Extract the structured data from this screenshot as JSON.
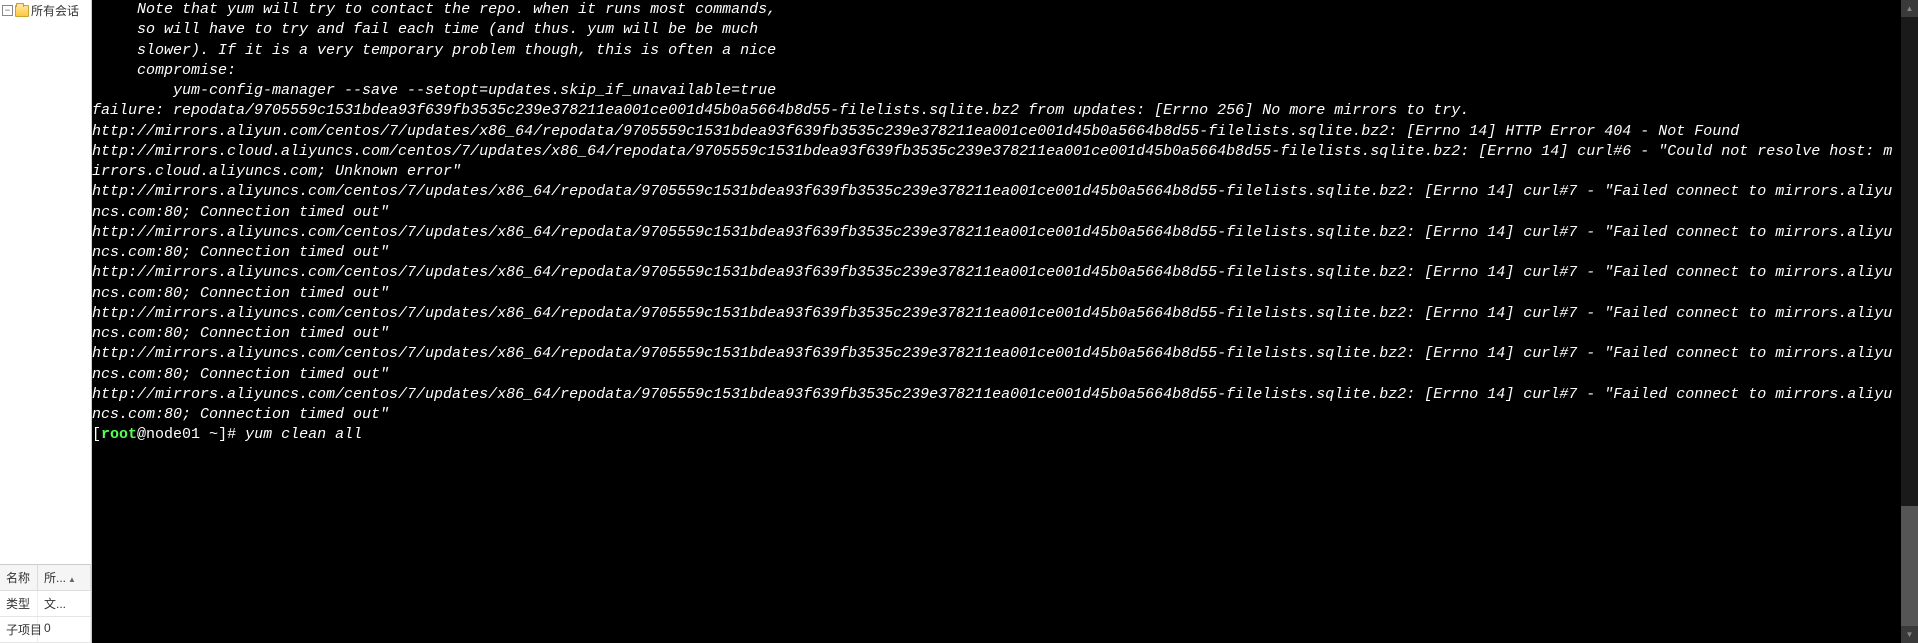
{
  "sidebar": {
    "tree": {
      "label": "所有会话"
    },
    "grid": {
      "headers": [
        "名称",
        "所..."
      ],
      "rows": [
        [
          "类型",
          "文..."
        ],
        [
          "子项目",
          "0"
        ]
      ]
    }
  },
  "terminal": {
    "note_lines": [
      "     Note that yum will try to contact the repo. when it runs most commands,",
      "     so will have to try and fail each time (and thus. yum will be be much",
      "     slower). If it is a very temporary problem though, this is often a nice",
      "     compromise:",
      "",
      "         yum-config-manager --save --setopt=updates.skip_if_unavailable=true",
      ""
    ],
    "failure_line": "failure: repodata/9705559c1531bdea93f639fb3535c239e378211ea001ce001d45b0a5664b8d55-filelists.sqlite.bz2 from updates: [Errno 256] No more mirrors to try.",
    "error_lines": [
      "http://mirrors.aliyun.com/centos/7/updates/x86_64/repodata/9705559c1531bdea93f639fb3535c239e378211ea001ce001d45b0a5664b8d55-filelists.sqlite.bz2: [Errno 14] HTTP Error 404 - Not Found",
      "http://mirrors.cloud.aliyuncs.com/centos/7/updates/x86_64/repodata/9705559c1531bdea93f639fb3535c239e378211ea001ce001d45b0a5664b8d55-filelists.sqlite.bz2: [Errno 14] curl#6 - \"Could not resolve host: mirrors.cloud.aliyuncs.com; Unknown error\"",
      "http://mirrors.aliyuncs.com/centos/7/updates/x86_64/repodata/9705559c1531bdea93f639fb3535c239e378211ea001ce001d45b0a5664b8d55-filelists.sqlite.bz2: [Errno 14] curl#7 - \"Failed connect to mirrors.aliyuncs.com:80; Connection timed out\"",
      "http://mirrors.aliyuncs.com/centos/7/updates/x86_64/repodata/9705559c1531bdea93f639fb3535c239e378211ea001ce001d45b0a5664b8d55-filelists.sqlite.bz2: [Errno 14] curl#7 - \"Failed connect to mirrors.aliyuncs.com:80; Connection timed out\"",
      "http://mirrors.aliyuncs.com/centos/7/updates/x86_64/repodata/9705559c1531bdea93f639fb3535c239e378211ea001ce001d45b0a5664b8d55-filelists.sqlite.bz2: [Errno 14] curl#7 - \"Failed connect to mirrors.aliyuncs.com:80; Connection timed out\"",
      "http://mirrors.aliyuncs.com/centos/7/updates/x86_64/repodata/9705559c1531bdea93f639fb3535c239e378211ea001ce001d45b0a5664b8d55-filelists.sqlite.bz2: [Errno 14] curl#7 - \"Failed connect to mirrors.aliyuncs.com:80; Connection timed out\"",
      "http://mirrors.aliyuncs.com/centos/7/updates/x86_64/repodata/9705559c1531bdea93f639fb3535c239e378211ea001ce001d45b0a5664b8d55-filelists.sqlite.bz2: [Errno 14] curl#7 - \"Failed connect to mirrors.aliyuncs.com:80; Connection timed out\"",
      "http://mirrors.aliyuncs.com/centos/7/updates/x86_64/repodata/9705559c1531bdea93f639fb3535c239e378211ea001ce001d45b0a5664b8d55-filelists.sqlite.bz2: [Errno 14] curl#7 - \"Failed connect to mirrors.aliyuncs.com:80; Connection timed out\""
    ],
    "prompt": {
      "user": "root",
      "host": "@node01",
      "path": " ~",
      "marker": "]# ",
      "command": "yum clean all"
    }
  }
}
